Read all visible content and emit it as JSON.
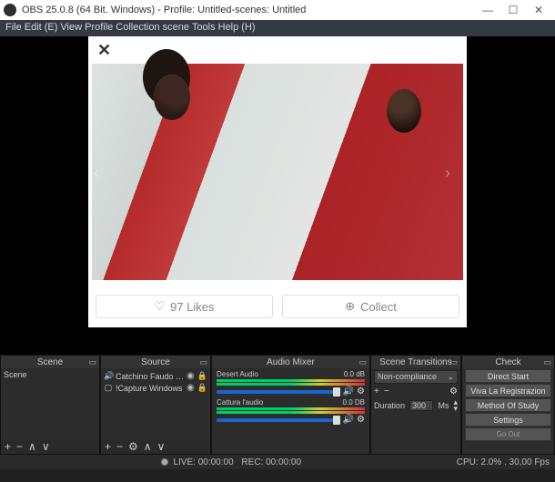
{
  "titlebar": {
    "title": "OBS 25.0.8 (64 Bit. Windows) - Profile: Untitled-scenes: Untitled"
  },
  "menubar": {
    "file": "File",
    "edit": "Edit (E)",
    "view": "View",
    "profile": "Profile",
    "collection": "Collection",
    "scene": "scene",
    "tools": "Tools",
    "help": "Help (H)"
  },
  "overlay": {
    "likes_label": "97 Likes",
    "collect_label": "Collect"
  },
  "panels": {
    "scene": {
      "title": "Scene",
      "name": "Scene"
    },
    "source": {
      "title": "Source",
      "items": [
        {
          "name": "Catchino Faudo In."
        },
        {
          "name": "!Capture Windows"
        }
      ]
    },
    "mixer": {
      "title": "Audio Mixer",
      "items": [
        {
          "name": "Desert Audio",
          "db": "0.0 dB"
        },
        {
          "name": "Cattura l'audio",
          "db": "0.0 DB"
        }
      ]
    },
    "transitions": {
      "title": "Scene Transitions",
      "selected": "Non-compliance",
      "duration_label": "Duration",
      "duration_value": "300",
      "duration_unit": "Ms"
    },
    "controls": {
      "title": "Check",
      "direct_start": "Direct Start",
      "viva": "Viva La Registrazion",
      "method": "Method Of Study",
      "settings": "Settings",
      "exit": "Go Out"
    }
  },
  "statusbar": {
    "live": "LIVE: 00:00:00",
    "rec": "REC: 00:00:00",
    "cpu": "CPU: 2.0% . 30,00 Fps"
  }
}
